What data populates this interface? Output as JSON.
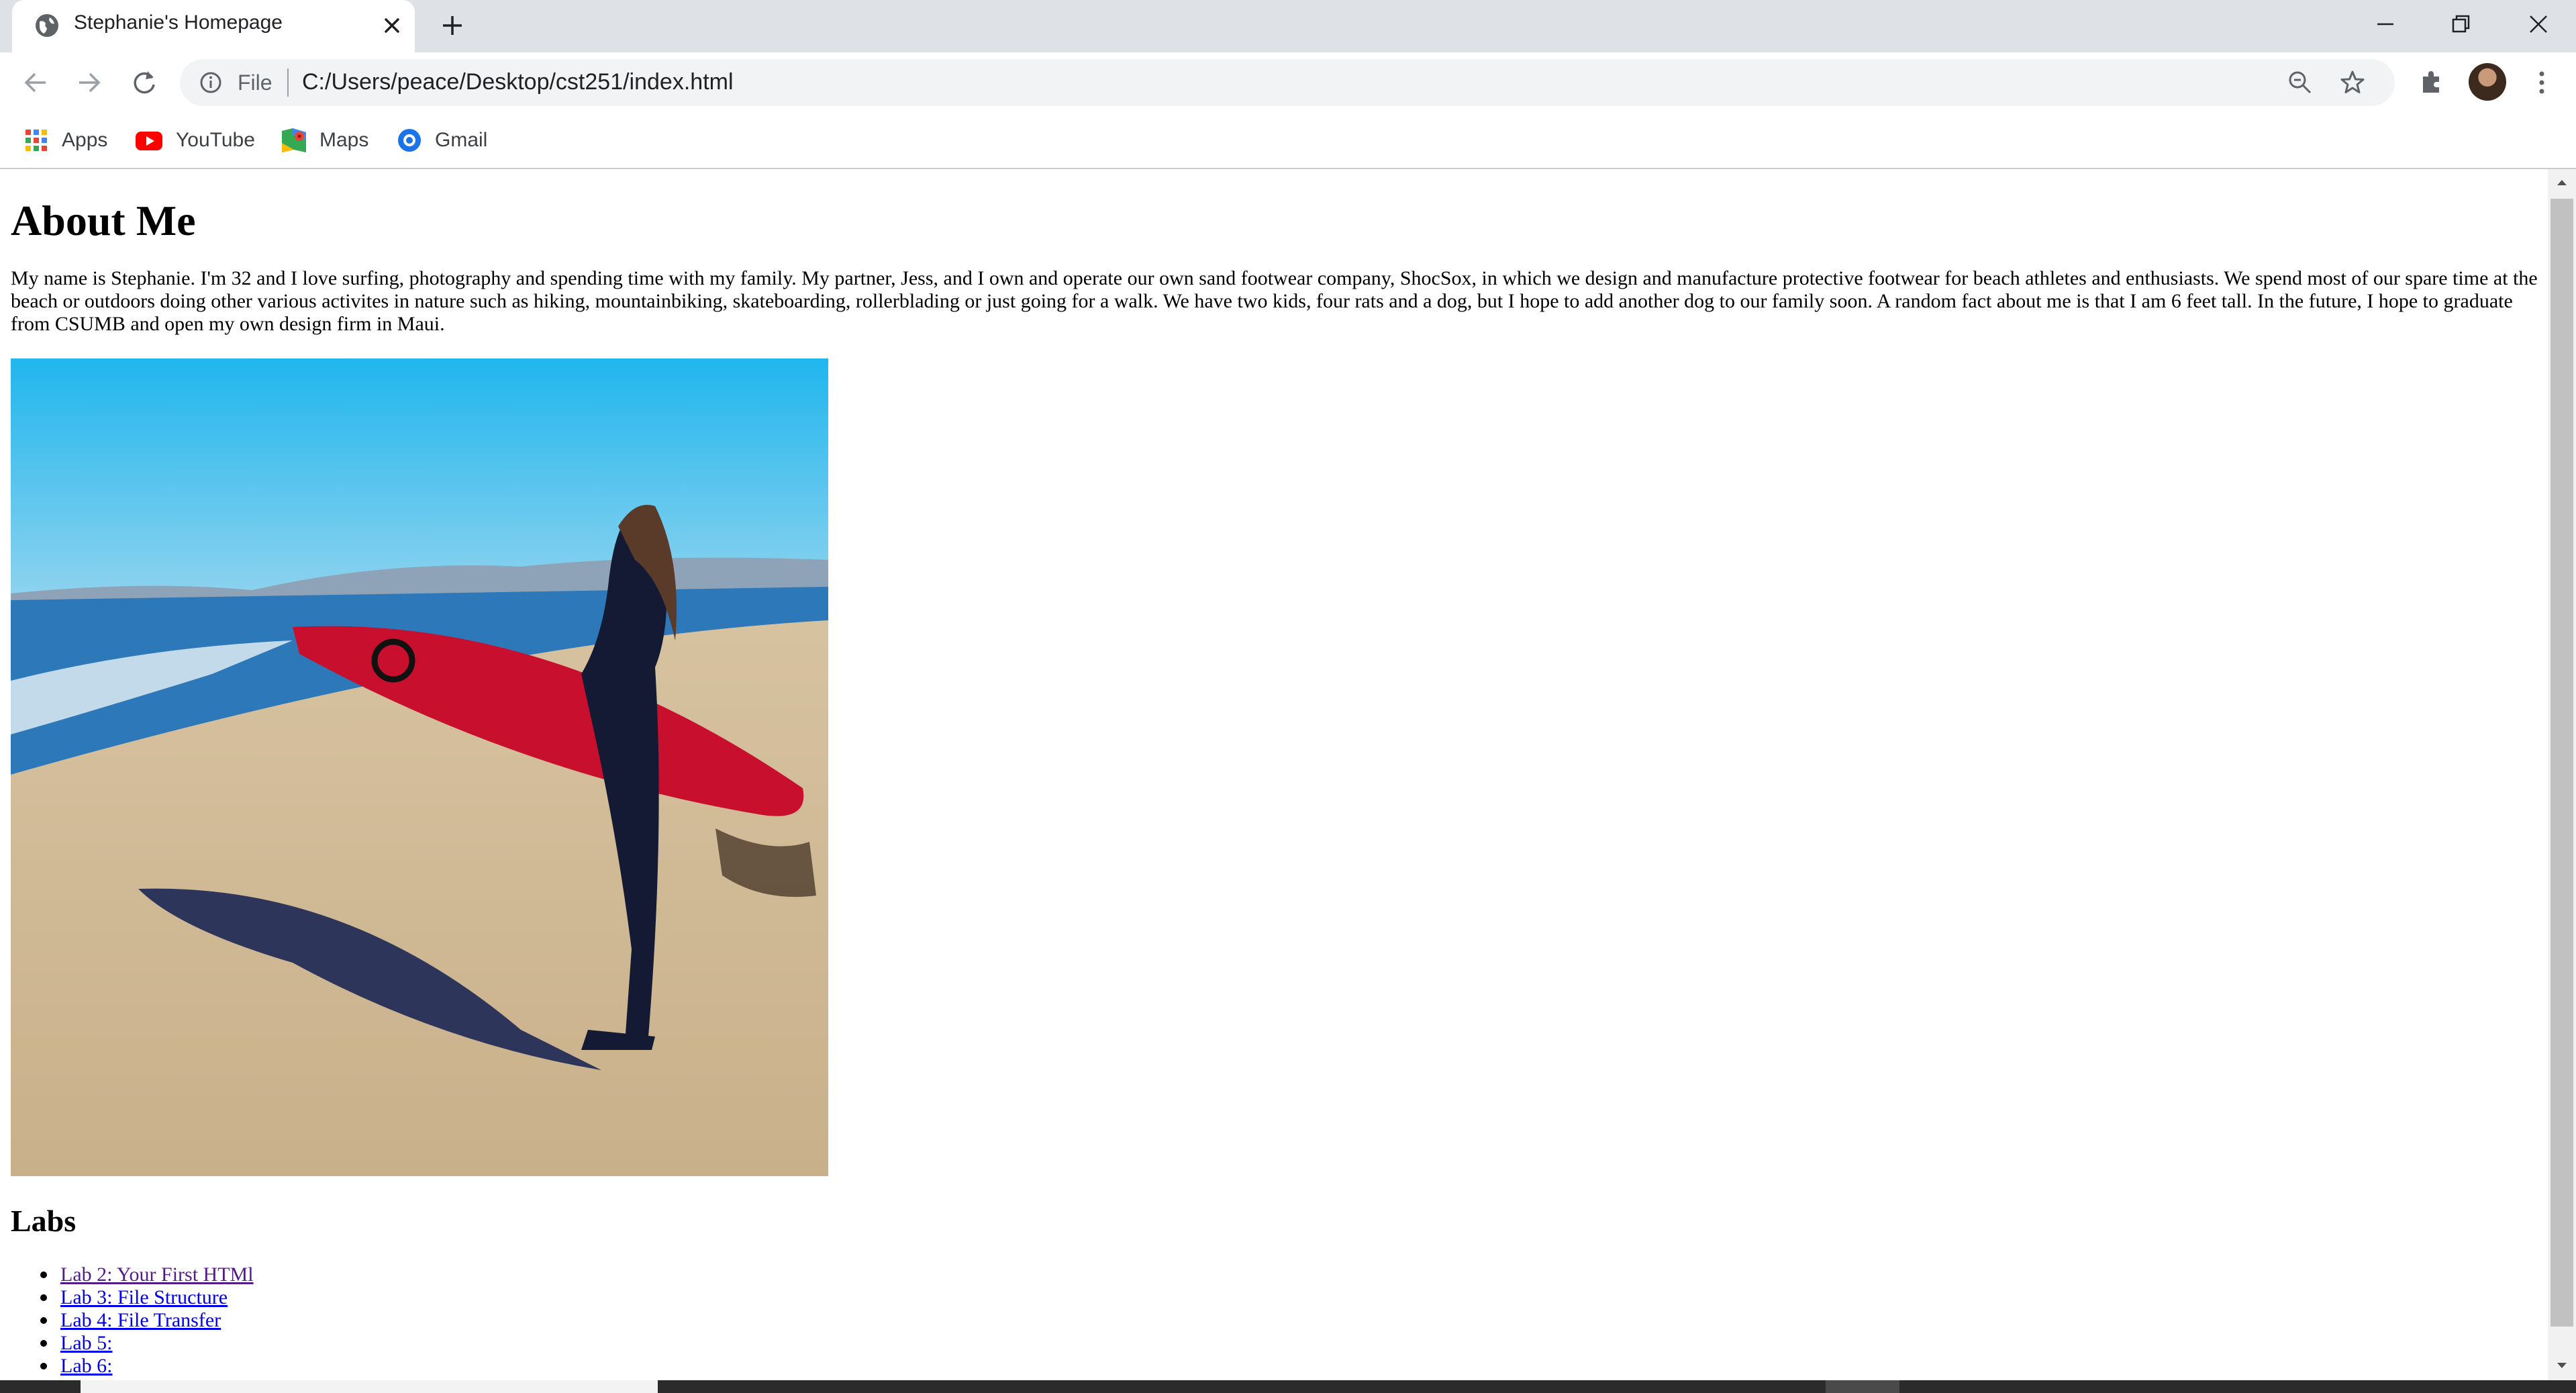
{
  "browser": {
    "tab_title": "Stephanie's Homepage",
    "file_label": "File",
    "url": "C:/Users/peace/Desktop/cst251/index.html",
    "bookmarks": [
      {
        "label": "Apps",
        "icon": "apps-grid-icon"
      },
      {
        "label": "YouTube",
        "icon": "youtube-icon"
      },
      {
        "label": "Maps",
        "icon": "maps-icon"
      },
      {
        "label": "Gmail",
        "icon": "gmail-icon"
      }
    ]
  },
  "page": {
    "heading": "About Me",
    "paragraph": "My name is Stephanie. I'm 32 and I love surfing, photography and spending time with my family. My partner, Jess, and I own and operate our own sand footwear company, ShocSox, in which we design and manufacture protective footwear for beach athletes and enthusiasts. We spend most of our spare time at the beach or outdoors doing other various activites in nature such as hiking, mountainbiking, skateboarding, rollerblading or just going for a walk. We have two kids, four rats and a dog, but I hope to add another dog to our family soon. A random fact about me is that I am 6 feet tall. In the future, I hope to graduate from CSUMB and open my own design firm in Maui.",
    "labs_heading": "Labs",
    "labs": [
      {
        "label": "Lab 2: Your First HTMl",
        "visited": true
      },
      {
        "label": "Lab 3: File Structure",
        "visited": false
      },
      {
        "label": "Lab 4: File Transfer",
        "visited": false
      },
      {
        "label": "Lab 5:",
        "visited": false
      },
      {
        "label": "Lab 6:",
        "visited": false
      }
    ]
  },
  "colors": {
    "link": "#0000ee",
    "visited_link": "#551a8b",
    "chrome_frame": "#dee1e6",
    "surfboard": "#c8102e"
  }
}
